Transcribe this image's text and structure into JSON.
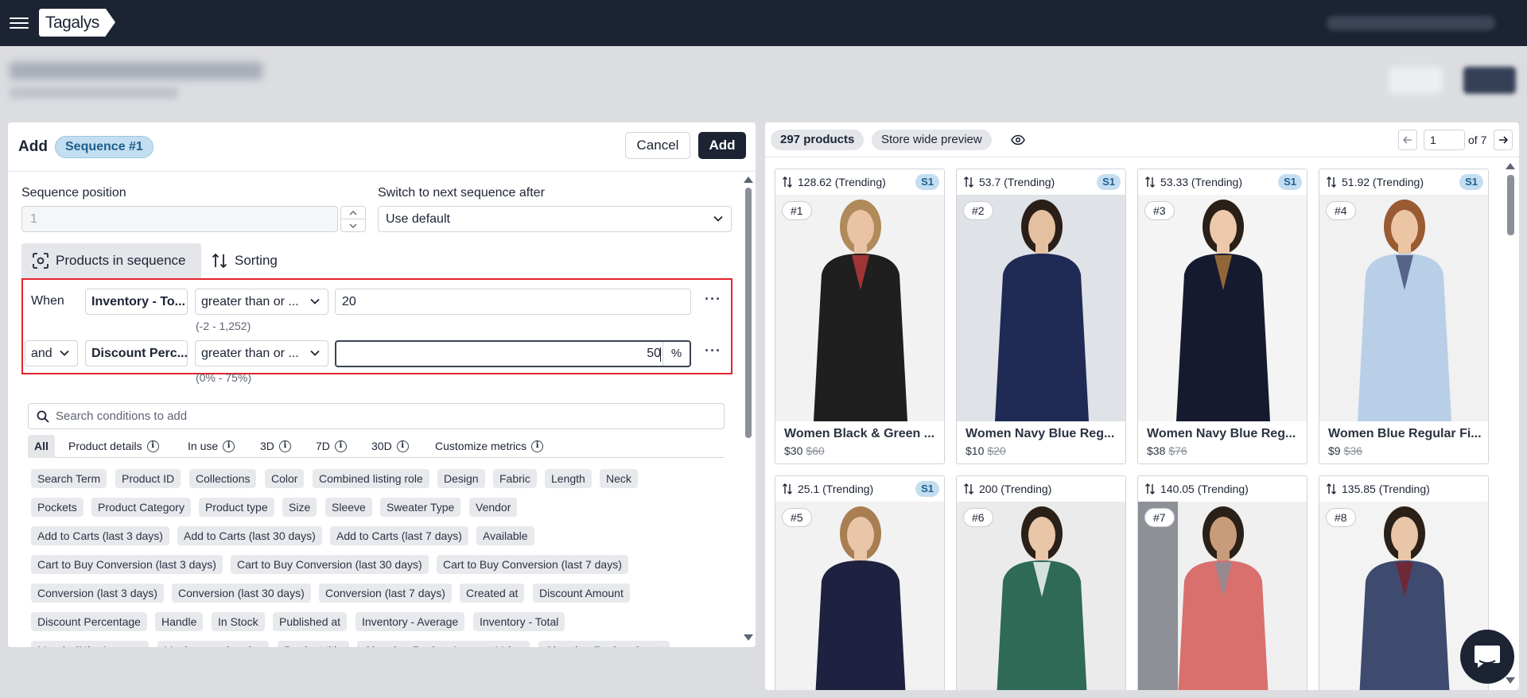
{
  "app": {
    "name": "Tagalys"
  },
  "left": {
    "title": "Add",
    "badge": "Sequence #1",
    "cancel": "Cancel",
    "add": "Add",
    "seq_pos_label": "Sequence position",
    "seq_pos_value": "1",
    "switch_label": "Switch to next sequence after",
    "switch_value": "Use default",
    "tabs": [
      "Products in sequence",
      "Sorting"
    ],
    "cond1": {
      "prefix": "When",
      "field": "Inventory - To...",
      "op": "greater than or ...",
      "value": "20",
      "range": "(-2 - 1,252)"
    },
    "cond2": {
      "prefix": "and",
      "field": "Discount Perc...",
      "op": "greater than or ...",
      "value": "50",
      "unit": "%",
      "range": "(0% - 75%)"
    },
    "search_placeholder": "Search conditions to add",
    "filter_tabs": [
      "All",
      "Product details",
      "In use",
      "3D",
      "7D",
      "30D",
      "Customize metrics"
    ],
    "chips": [
      [
        "Search Term",
        "Product ID",
        "Collections",
        "Color",
        "Combined listing role",
        "Design",
        "Fabric",
        "Length",
        "Neck"
      ],
      [
        "Pockets",
        "Product Category",
        "Product type",
        "Size",
        "Sleeve",
        "Sweater Type",
        "Vendor"
      ],
      [
        "Add to Carts (last 3 days)",
        "Add to Carts (last 30 days)",
        "Add to Carts (last 7 days)",
        "Available"
      ],
      [
        "Cart to Buy Conversion (last 3 days)",
        "Cart to Buy Conversion (last 30 days)",
        "Cart to Buy Conversion (last 7 days)"
      ],
      [
        "Conversion (last 3 days)",
        "Conversion (last 30 days)",
        "Conversion (last 7 days)",
        "Created at",
        "Discount Amount"
      ],
      [
        "Discount Percentage",
        "Handle",
        "In Stock",
        "Published at",
        "Inventory - Average",
        "Inventory - Total"
      ],
      [
        "Margin (%) - Average",
        "Maximum sale price",
        "Product title",
        "Okendo - Review Average Value",
        "Okendo - Review Count"
      ]
    ]
  },
  "right": {
    "count": "297 products",
    "preview": "Store wide preview",
    "page": "1",
    "of": "of 7",
    "products": [
      {
        "score": "128.62 (Trending)",
        "badge": "S1",
        "rank": "#1",
        "name": "Women Black & Green ...",
        "price": "$30",
        "old": "$60"
      },
      {
        "score": "53.7 (Trending)",
        "badge": "S1",
        "rank": "#2",
        "name": "Women Navy Blue Reg...",
        "price": "$10",
        "old": "$20"
      },
      {
        "score": "53.33 (Trending)",
        "badge": "S1",
        "rank": "#3",
        "name": "Women Navy Blue Reg...",
        "price": "$38",
        "old": "$76"
      },
      {
        "score": "51.92 (Trending)",
        "badge": "S1",
        "rank": "#4",
        "name": "Women Blue Regular Fi...",
        "price": "$9",
        "old": "$36"
      },
      {
        "score": "25.1 (Trending)",
        "badge": "S1",
        "rank": "#5",
        "name": "",
        "price": "",
        "old": ""
      },
      {
        "score": "200 (Trending)",
        "badge": "",
        "rank": "#6",
        "name": "",
        "price": "",
        "old": ""
      },
      {
        "score": "140.05 (Trending)",
        "badge": "",
        "rank": "#7",
        "name": "",
        "price": "",
        "old": ""
      },
      {
        "score": "135.85 (Trending)",
        "badge": "",
        "rank": "#8",
        "name": "",
        "price": "",
        "old": ""
      }
    ]
  }
}
